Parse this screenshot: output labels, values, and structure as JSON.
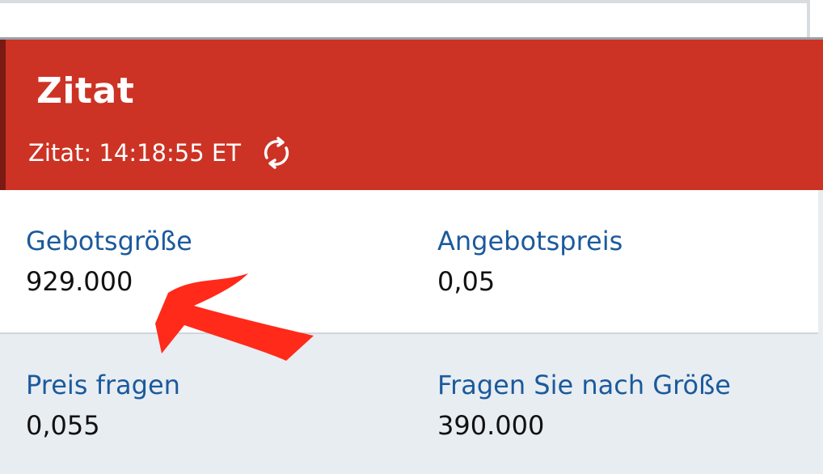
{
  "header": {
    "title": "Zitat",
    "quote_time": "Zitat: 14:18:55 ET",
    "refresh_icon": "refresh-icon",
    "color": "#cc3324"
  },
  "quote": {
    "bid_size_label": "Gebotsgröße",
    "bid_size_value": "929.000",
    "offer_price_label": "Angebotspreis",
    "offer_price_value": "0,05",
    "ask_price_label": "Preis fragen",
    "ask_price_value": "0,055",
    "ask_size_label": "Fragen Sie nach Größe",
    "ask_size_value": "390.000"
  },
  "annotation": {
    "arrow_color": "#ff2a1a"
  }
}
